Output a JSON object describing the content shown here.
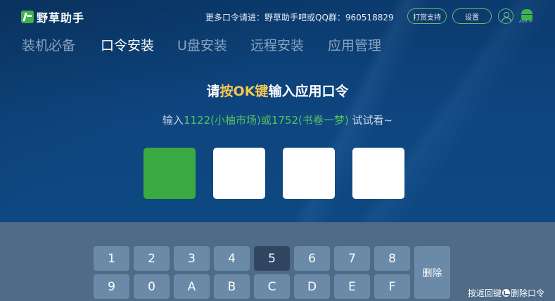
{
  "header": {
    "app_name": "野草助手",
    "promo_text": "更多口令请进：野草助手吧或QQ群：960518829",
    "tip_button": "打赏支持",
    "settings_button": "设置",
    "android_label": "ADB 中"
  },
  "tabs": [
    {
      "label": "装机必备",
      "active": false
    },
    {
      "label": "口令安装",
      "active": true
    },
    {
      "label": "U盘安装",
      "active": false
    },
    {
      "label": "远程安装",
      "active": false
    },
    {
      "label": "应用管理",
      "active": false
    }
  ],
  "main": {
    "title_prefix": "请",
    "title_highlight": "按OK键",
    "title_suffix": "输入应用口令",
    "subtitle_prefix": "输入",
    "subtitle_code1": "1122(小柚市场)",
    "subtitle_or": "或",
    "subtitle_code2": "1752(书卷一梦)",
    "subtitle_suffix": " 试试看~",
    "code_slots": [
      "",
      "",
      "",
      ""
    ],
    "active_slot": 1
  },
  "keyboard": {
    "row1": [
      "1",
      "2",
      "3",
      "4",
      "5",
      "6",
      "7",
      "8"
    ],
    "row2": [
      "9",
      "0",
      "A",
      "B",
      "C",
      "D",
      "E",
      "F"
    ],
    "selected_key": "5",
    "delete_label": "删除"
  },
  "footer": {
    "hint_prefix": "按返回键",
    "hint_suffix": "删除口令"
  },
  "colors": {
    "accent_green": "#3aaa43",
    "highlight_yellow": "#f3c553",
    "background_blue": "#0d4a82"
  }
}
